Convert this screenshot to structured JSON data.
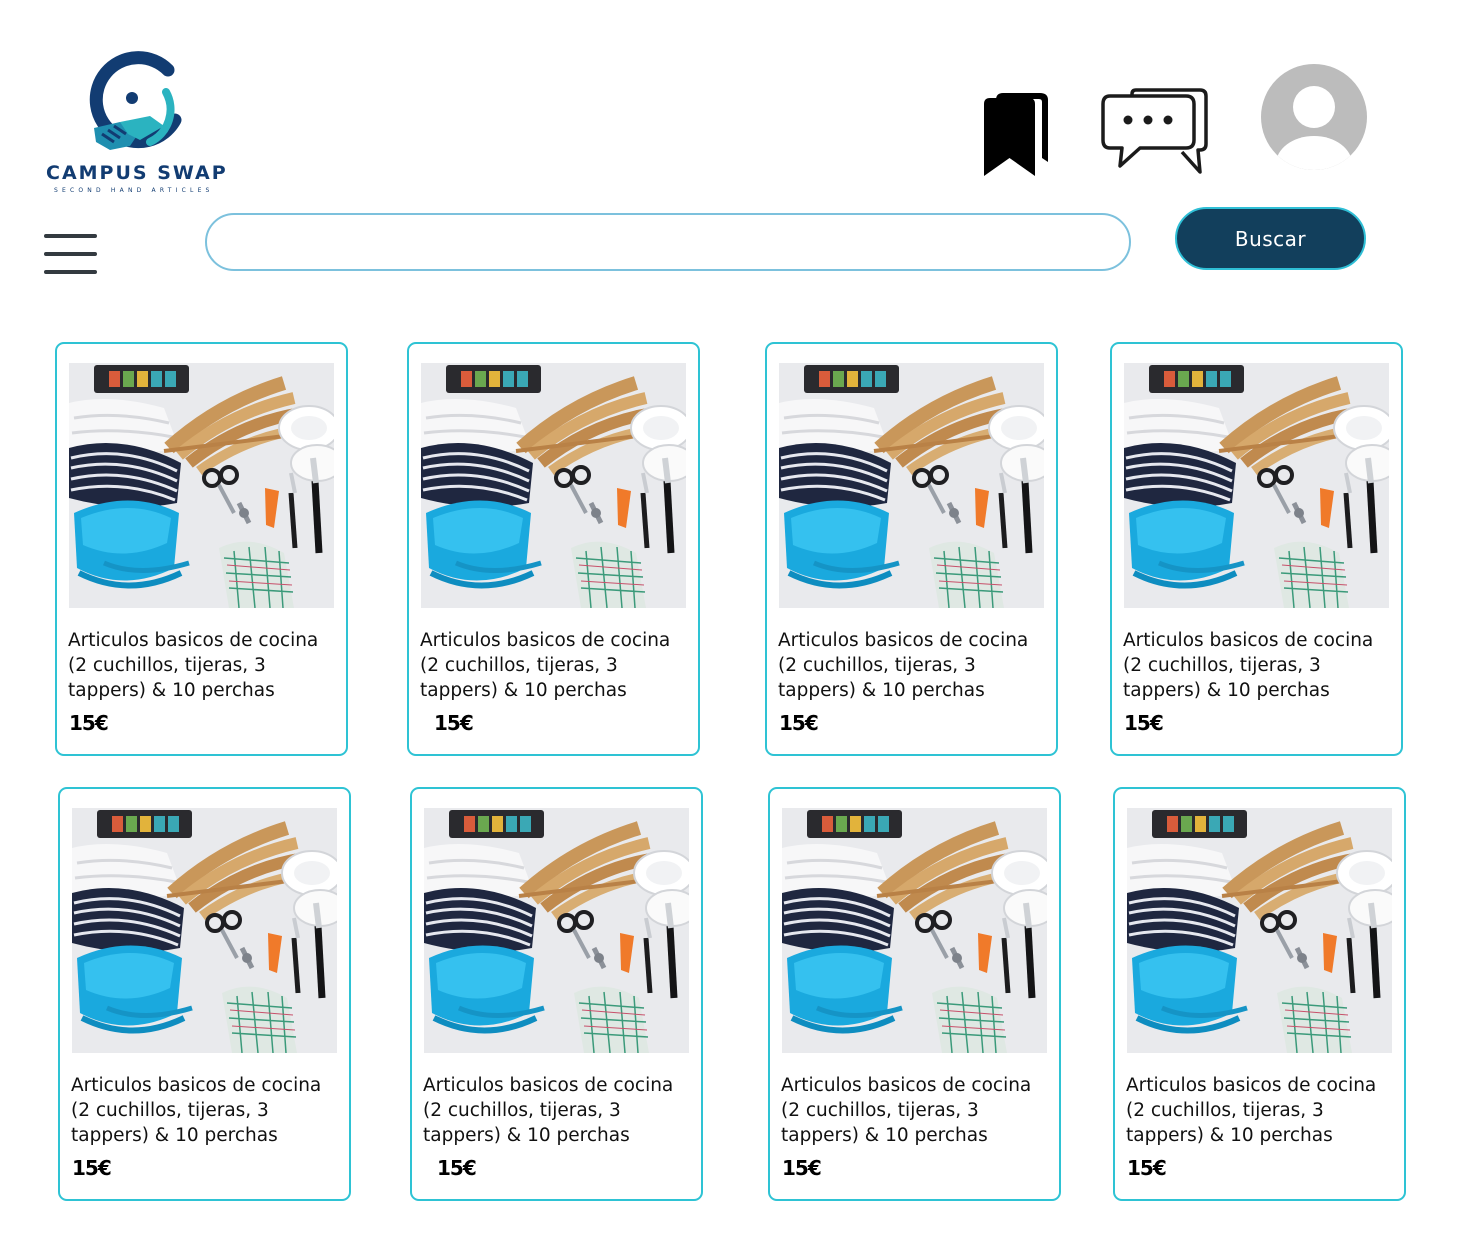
{
  "brand": {
    "name": "CAMPUS SWAP",
    "tagline": "SECOND HAND ARTICLES",
    "colors": {
      "navy": "#123c72",
      "teal": "#2bb3c0"
    }
  },
  "header": {
    "bookmarks_icon": "bookmark-icon",
    "messages_icon": "chat-bubbles-icon",
    "avatar_icon": "user-avatar-icon",
    "menu_icon": "hamburger-menu-icon"
  },
  "search": {
    "value": "",
    "placeholder": "",
    "button_label": "Buscar",
    "button_color": "#123f5c",
    "border_color": "#7cc1dd"
  },
  "products": [
    {
      "title": "Articulos basicos de cocina (2 cuchillos, tijeras, 3 tappers) & 10 perchas",
      "price": "15€"
    },
    {
      "title": "Articulos basicos de cocina (2 cuchillos, tijeras, 3 tappers) & 10 perchas",
      "price": "15€"
    },
    {
      "title": "Articulos basicos de cocina (2 cuchillos, tijeras, 3 tappers) & 10 perchas",
      "price": "15€"
    },
    {
      "title": "Articulos basicos de cocina (2 cuchillos, tijeras, 3 tappers) & 10 perchas",
      "price": "15€"
    },
    {
      "title": "Articulos basicos de cocina (2 cuchillos, tijeras, 3 tappers) & 10 perchas",
      "price": "15€"
    },
    {
      "title": "Articulos basicos de cocina (2 cuchillos, tijeras, 3 tappers) & 10 perchas",
      "price": "15€"
    },
    {
      "title": "Articulos basicos de cocina (2 cuchillos, tijeras, 3 tappers) & 10 perchas",
      "price": "15€"
    },
    {
      "title": "Articulos basicos de cocina (2 cuchillos, tijeras, 3 tappers) & 10 perchas",
      "price": "15€"
    }
  ],
  "card_border_color": "#2ec3d4"
}
